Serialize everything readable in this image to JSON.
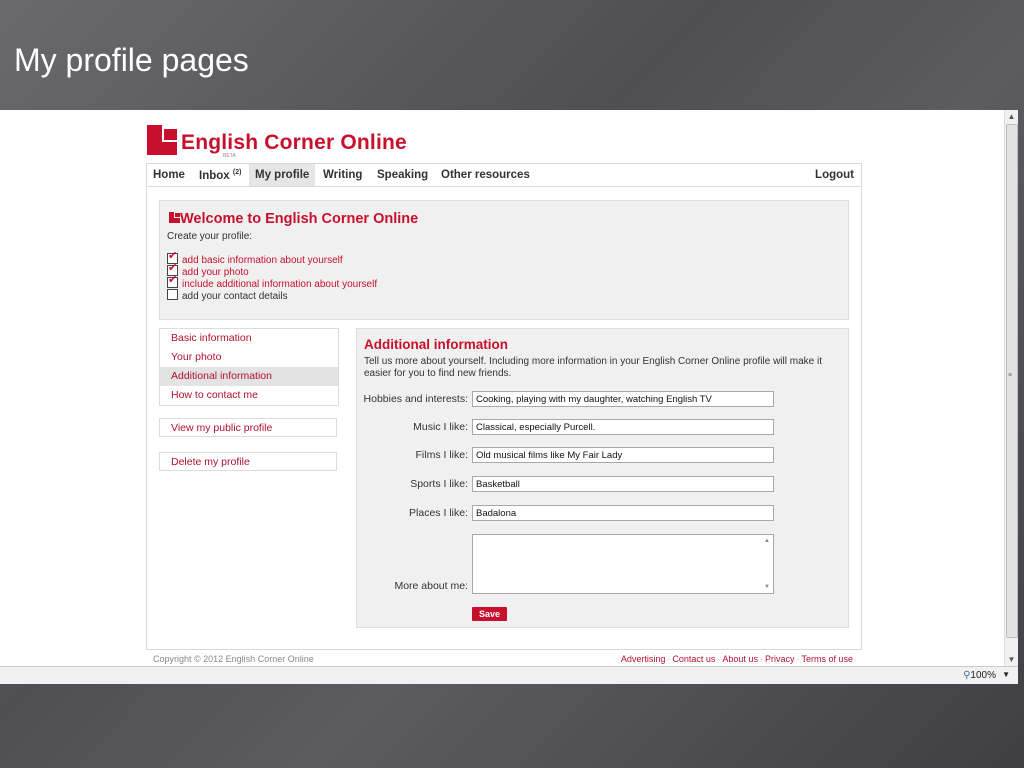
{
  "slide": {
    "title": "My profile pages"
  },
  "site": {
    "logo_text": "English Corner Online",
    "beta": "BETA"
  },
  "nav": {
    "home": "Home",
    "inbox": "Inbox",
    "inbox_count": "(2)",
    "my_profile": "My profile",
    "writing": "Writing",
    "speaking": "Speaking",
    "other_resources": "Other resources",
    "logout": "Logout"
  },
  "welcome": {
    "title": "Welcome to English Corner Online",
    "subtitle": "Create your profile:",
    "checklist": [
      {
        "label": "add basic information about yourself",
        "checked": true
      },
      {
        "label": "add your photo",
        "checked": true
      },
      {
        "label": "include additional information about yourself",
        "checked": true
      },
      {
        "label": "add your contact details",
        "checked": false
      }
    ]
  },
  "sidebar": {
    "items": [
      "Basic information",
      "Your photo",
      "Additional information",
      "How to contact me"
    ],
    "selected": "Additional information",
    "view_public": "View my public profile",
    "delete": "Delete my profile"
  },
  "content": {
    "title": "Additional information",
    "description": "Tell us more about yourself. Including more information in your English Corner Online profile will make it easier for you to find new friends.",
    "fields": {
      "hobbies_label": "Hobbies and interests:",
      "hobbies_value": "Cooking, playing with my daughter, watching English TV",
      "music_label": "Music I like:",
      "music_value": "Classical, especially Purcell.",
      "films_label": "Films I like:",
      "films_value": "Old musical films like My Fair Lady",
      "sports_label": "Sports I like:",
      "sports_value": "Basketball",
      "places_label": "Places I like:",
      "places_value": "Badalona",
      "more_label": "More about me:",
      "more_value": ""
    },
    "save_label": "Save"
  },
  "footer": {
    "copyright": "Copyright © 2012 English Corner Online",
    "links": [
      "Advertising",
      "Contact us",
      "About us",
      "Privacy",
      "Terms of use"
    ]
  },
  "browser": {
    "zoom": "100%"
  },
  "colors": {
    "brand": "#c8102e",
    "panel": "#f0f0f0"
  }
}
